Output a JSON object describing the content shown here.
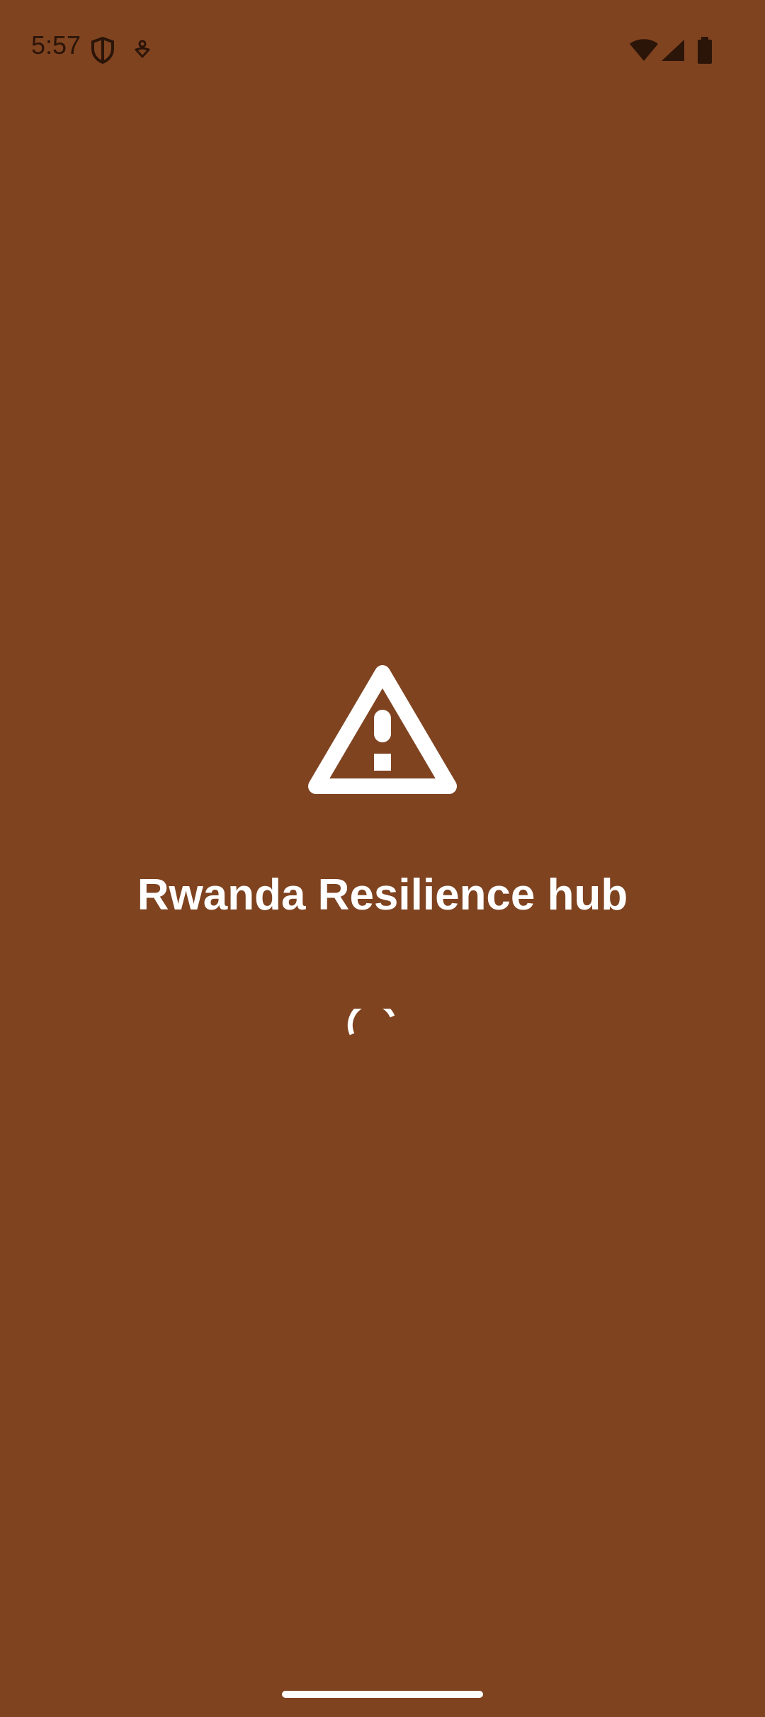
{
  "status_bar": {
    "time": "5:57",
    "left_icons": [
      "shield-icon",
      "accessibility-icon"
    ],
    "right_icons": [
      "wifi-icon",
      "signal-icon",
      "battery-icon"
    ]
  },
  "splash": {
    "icon": "warning-icon",
    "title": "Rwanda Resilience hub",
    "loading": true
  },
  "colors": {
    "background": "#7F4320",
    "foreground": "#FFFFFF",
    "status_icons": "#2B1408"
  }
}
